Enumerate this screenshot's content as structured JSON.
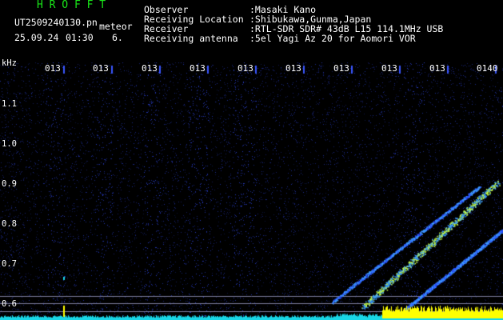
{
  "header": {
    "logo": "H R O F F T",
    "filename": "UT2509240130.pn",
    "mode": "meteor",
    "date": "25.09.24",
    "time": "01:30",
    "count": "6."
  },
  "info": {
    "labels": [
      "Observer",
      "Receiving Location",
      "Receiver",
      "Receiving antenna"
    ],
    "values": [
      ":Masaki Kano",
      ":Shibukawa,Gunma,Japan",
      ":RTL-SDR SDR# 43dB L15 114.1MHz USB",
      ":5el Yagi Az 20 for Aomori VOR"
    ]
  },
  "axis": {
    "unit": "kHz",
    "ylabels": [
      "1.1",
      "1.0",
      "0.9",
      "0.8",
      "0.7",
      "0.6"
    ],
    "xlabels": [
      "013",
      "013",
      "013",
      "013",
      "013",
      "013",
      "013",
      "013",
      "013",
      "0140"
    ]
  },
  "colors": {
    "background": "#000000",
    "noise": "#1a2fb0",
    "trail": "#3fa0ff",
    "trail_core": "#c8ff40",
    "baseline": "#19d6e6",
    "carrier": "#ffff00",
    "logo": "#19e619",
    "text": "#ffffff"
  }
}
